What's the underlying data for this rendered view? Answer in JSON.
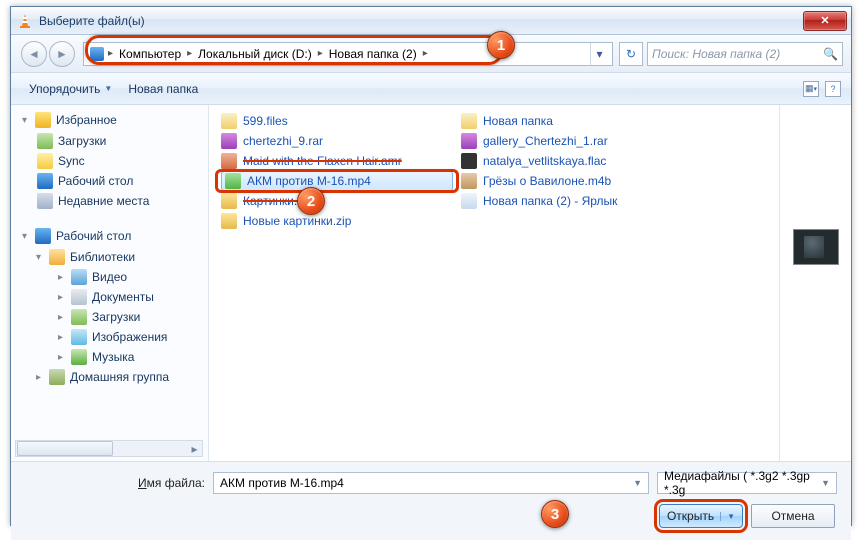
{
  "title": "Выберите файл(ы)",
  "breadcrumb": {
    "b0": "Компьютер",
    "b1": "Локальный диск (D:)",
    "b2": "Новая папка (2)"
  },
  "search": {
    "placeholder": "Поиск: Новая папка (2)"
  },
  "toolbar": {
    "organize": "Упорядочить",
    "newfolder": "Новая папка"
  },
  "sidebar": {
    "fav": "Избранное",
    "downloads": "Загрузки",
    "sync": "Sync",
    "desktop": "Рабочий стол",
    "recent": "Недавние места",
    "desktop2": "Рабочий стол",
    "libs": "Библиотеки",
    "video": "Видео",
    "docs": "Документы",
    "downloads2": "Загрузки",
    "images": "Изображения",
    "music": "Музыка",
    "homegroup": "Домашняя группа"
  },
  "files": {
    "l0": "599.files",
    "l1": "chertezhi_9.rar",
    "l2": "Maid with the Flaxen Hair.amr",
    "l3": "АКМ против М-16.mp4",
    "l4": "Картинки.zip",
    "l5": "Новые картинки.zip",
    "r0": "Новая папка",
    "r1": "gallery_Chertezhi_1.rar",
    "r2": "natalya_vetlitskaya.flac",
    "r3": "Грёзы о Вавилоне.m4b",
    "r4": "Новая папка (2) - Ярлык"
  },
  "footer": {
    "label_pre": "Имя файла:",
    "filename": "АКМ против М-16.mp4",
    "filter": "Медиафайлы ( *.3g2 *.3gp *.3g",
    "open": "Открыть",
    "cancel": "Отмена"
  },
  "callouts": {
    "c1": "1",
    "c2": "2",
    "c3": "3"
  }
}
